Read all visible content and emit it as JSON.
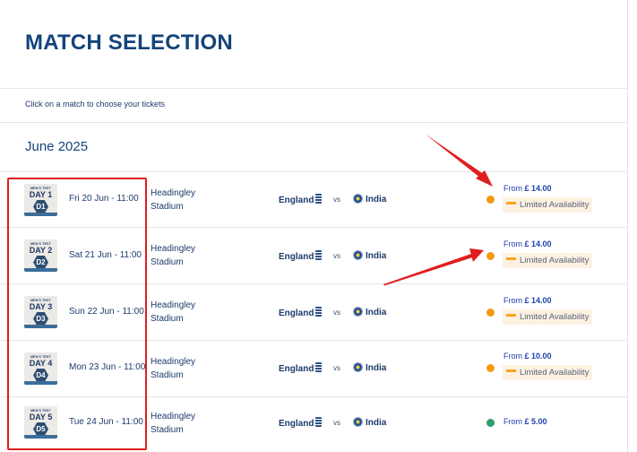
{
  "page": {
    "title": "MATCH SELECTION",
    "instruction": "Click on a match to choose your tickets",
    "month": "June 2025"
  },
  "matches": [
    {
      "badge_top": "MEN'S TEST",
      "badge_day": "DAY 1",
      "badge_num": "D1",
      "date": "Fri 20 Jun - 11:00",
      "venue_line1": "Headingley",
      "venue_line2": "Stadium",
      "team1": "England",
      "vs": "vs",
      "team2": "India",
      "status_color": "#f39c12",
      "price_prefix": "From",
      "price": "£ 14.00",
      "availability": "Limited Availability"
    },
    {
      "badge_top": "MEN'S TEST",
      "badge_day": "DAY 2",
      "badge_num": "D2",
      "date": "Sat 21 Jun - 11:00",
      "venue_line1": "Headingley",
      "venue_line2": "Stadium",
      "team1": "England",
      "vs": "vs",
      "team2": "India",
      "status_color": "#f39c12",
      "price_prefix": "From",
      "price": "£ 14.00",
      "availability": "Limited Availability"
    },
    {
      "badge_top": "MEN'S TEST",
      "badge_day": "DAY 3",
      "badge_num": "D3",
      "date": "Sun 22 Jun - 11:00",
      "venue_line1": "Headingley",
      "venue_line2": "Stadium",
      "team1": "England",
      "vs": "vs",
      "team2": "India",
      "status_color": "#f39c12",
      "price_prefix": "From",
      "price": "£ 14.00",
      "availability": "Limited Availability"
    },
    {
      "badge_top": "MEN'S TEST",
      "badge_day": "DAY 4",
      "badge_num": "D4",
      "date": "Mon 23 Jun - 11:00",
      "venue_line1": "Headingley",
      "venue_line2": "Stadium",
      "team1": "England",
      "vs": "vs",
      "team2": "India",
      "status_color": "#f39c12",
      "price_prefix": "From",
      "price": "£ 10.00",
      "availability": "Limited Availability"
    },
    {
      "badge_top": "MEN'S TEST",
      "badge_day": "DAY 5",
      "badge_num": "D5",
      "date": "Tue 24 Jun - 11:00",
      "venue_line1": "Headingley",
      "venue_line2": "Stadium",
      "team1": "England",
      "vs": "vs",
      "team2": "India",
      "status_color": "#2e9e6a",
      "price_prefix": "From",
      "price": "£ 5.00",
      "availability": ""
    }
  ],
  "annotations": {
    "highlight_color": "#e11d1d",
    "arrow_color": "#e11d1d"
  }
}
